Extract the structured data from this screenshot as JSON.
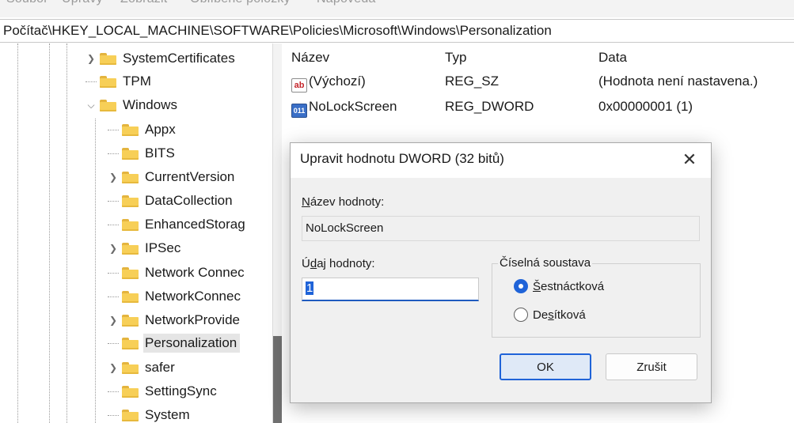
{
  "window": {
    "menu": [
      "Soubor",
      "Úpravy",
      "Zobrazit",
      "Oblíbené položky",
      "Nápověda"
    ]
  },
  "address": "Počítač\\HKEY_LOCAL_MACHINE\\SOFTWARE\\Policies\\Microsoft\\Windows\\Personalization",
  "tree": {
    "items": [
      {
        "label": "SystemCertificates",
        "expander": "chevron-right"
      },
      {
        "label": "TPM",
        "expander": "none"
      },
      {
        "label": "Windows",
        "expander": "chevron-down"
      },
      {
        "label": "Appx",
        "expander": "none"
      },
      {
        "label": "BITS",
        "expander": "none"
      },
      {
        "label": "CurrentVersion",
        "expander": "chevron-right"
      },
      {
        "label": "DataCollection",
        "expander": "none"
      },
      {
        "label": "EnhancedStorag",
        "expander": "none"
      },
      {
        "label": "IPSec",
        "expander": "chevron-right"
      },
      {
        "label": "Network Connec",
        "expander": "none"
      },
      {
        "label": "NetworkConnec",
        "expander": "none"
      },
      {
        "label": "NetworkProvide",
        "expander": "chevron-right"
      },
      {
        "label": "Personalization",
        "expander": "none",
        "selected": true
      },
      {
        "label": "safer",
        "expander": "chevron-right"
      },
      {
        "label": "SettingSync",
        "expander": "none"
      },
      {
        "label": "System",
        "expander": "none"
      }
    ]
  },
  "values_list": {
    "headers": {
      "name": "Název",
      "type": "Typ",
      "data": "Data"
    },
    "rows": [
      {
        "icon": "string-value-icon",
        "icon_text": "ab",
        "name": "(Výchozí)",
        "type": "REG_SZ",
        "data": "(Hodnota není nastavena.)"
      },
      {
        "icon": "binary-value-icon",
        "icon_text": "011",
        "name": "NoLockScreen",
        "type": "REG_DWORD",
        "data": "0x00000001 (1)"
      }
    ]
  },
  "dialog": {
    "title": "Upravit hodnotu DWORD (32 bitů)",
    "close_glyph": "✕",
    "name_label_hotkey": "N",
    "name_label_rest": "ázev hodnoty:",
    "name_value": "NoLockScreen",
    "data_label_pre": "Ú",
    "data_label_hotkey": "d",
    "data_label_rest": "aj hodnoty:",
    "data_value": "1",
    "base_legend": "Číselná soustava",
    "radio_hex_hotkey": "Š",
    "radio_hex_rest": "estnáctková",
    "radio_dec_pre": "De",
    "radio_dec_hotkey": "s",
    "radio_dec_rest": "ítková",
    "selected_base": "hex",
    "ok_label": "OK",
    "cancel_label": "Zrušit"
  },
  "colors": {
    "accent": "#1f63d8",
    "folder": "#f7cf57",
    "selection": "#e5e5e5"
  }
}
